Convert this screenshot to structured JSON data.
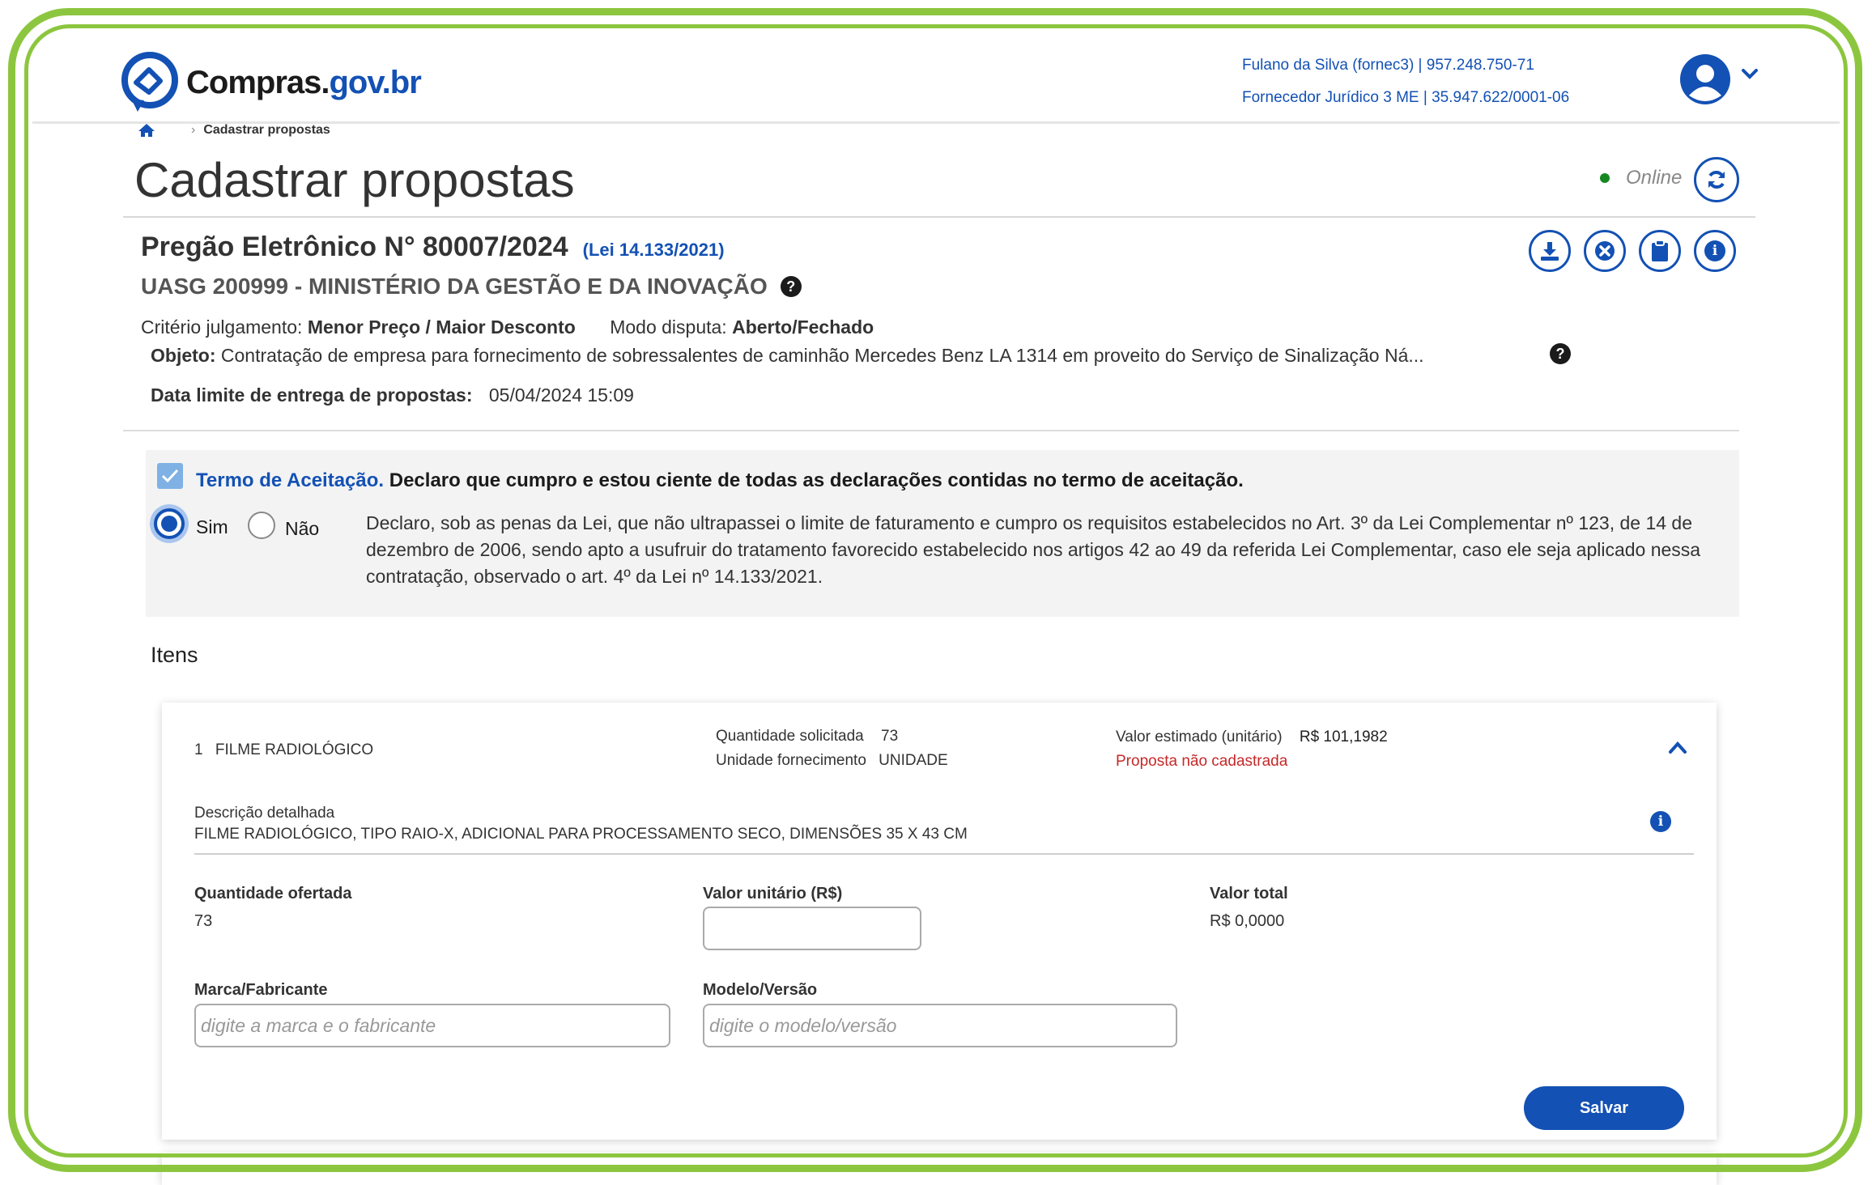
{
  "header": {
    "logo_prefix": "Compras.",
    "logo_suffix": "gov.br",
    "user_line1": "Fulano da Silva (fornec3) | 957.248.750-71",
    "user_line2": "Fornecedor Jurídico 3 ME | 35.947.622/0001-06"
  },
  "breadcrumb": {
    "current": "Cadastrar propostas"
  },
  "page": {
    "title": "Cadastrar propostas",
    "status": "Online",
    "pregao": "Pregão Eletrônico N° 80007/2024",
    "lei": "(Lei 14.133/2021)",
    "uasg": "UASG 200999 - MINISTÉRIO DA GESTÃO E DA INOVAÇÃO",
    "criterio_label": "Critério julgamento:",
    "criterio_value": "Menor Preço / Maior Desconto",
    "modo_label": "Modo disputa:",
    "modo_value": "Aberto/Fechado",
    "objeto_label": "Objeto:",
    "objeto_value": "Contratação de empresa para fornecimento de sobressalentes de caminhão Mercedes Benz LA 1314 em proveito do Serviço de Sinalização Ná...",
    "data_limite_label": "Data limite de entrega de propostas:",
    "data_limite_value": "05/04/2024 15:09"
  },
  "termo": {
    "link": "Termo de Aceitação.",
    "text": "Declaro que cumpro e estou ciente de todas as declarações contidas no termo de aceitação.",
    "checked": true,
    "sim": "Sim",
    "nao": "Não",
    "selected": "Sim",
    "declaracao": "Declaro, sob as penas da Lei, que não ultrapassei o limite de faturamento e cumpro os requisitos estabelecidos no Art. 3º da Lei Complementar nº 123, de 14 de dezembro de 2006, sendo apto a usufruir do tratamento favorecido estabelecido nos artigos 42 ao 49 da referida Lei Complementar, caso ele seja aplicado nessa contratação, observado o art. 4º da Lei nº 14.133/2021."
  },
  "itens": {
    "heading": "Itens",
    "item": {
      "number": "1",
      "name": "FILME RADIOLÓGICO",
      "qtd_label": "Quantidade solicitada",
      "qtd_value": "73",
      "unidade_label": "Unidade fornecimento",
      "unidade_value": "UNIDADE",
      "valor_est_label": "Valor estimado (unitário)",
      "valor_est_value": "R$ 101,1982",
      "status": "Proposta não cadastrada",
      "desc_label": "Descrição detalhada",
      "desc_value": "FILME RADIOLÓGICO, TIPO RAIO-X, ADICIONAL PARA PROCESSAMENTO SECO, DIMENSÕES 35 X 43 CM",
      "qtd_ofertada_label": "Quantidade ofertada",
      "qtd_ofertada_value": "73",
      "valor_unit_label": "Valor unitário (R$)",
      "valor_unit_value": "",
      "valor_total_label": "Valor total",
      "valor_total_value": "R$ 0,0000",
      "marca_label": "Marca/Fabricante",
      "marca_placeholder": "digite a marca e o fabricante",
      "modelo_label": "Modelo/Versão",
      "modelo_placeholder": "digite o modelo/versão",
      "save_label": "Salvar"
    }
  },
  "colors": {
    "brand": "#1351b4",
    "frame": "#8cc63f",
    "online": "#168821",
    "error": "#c62828"
  }
}
